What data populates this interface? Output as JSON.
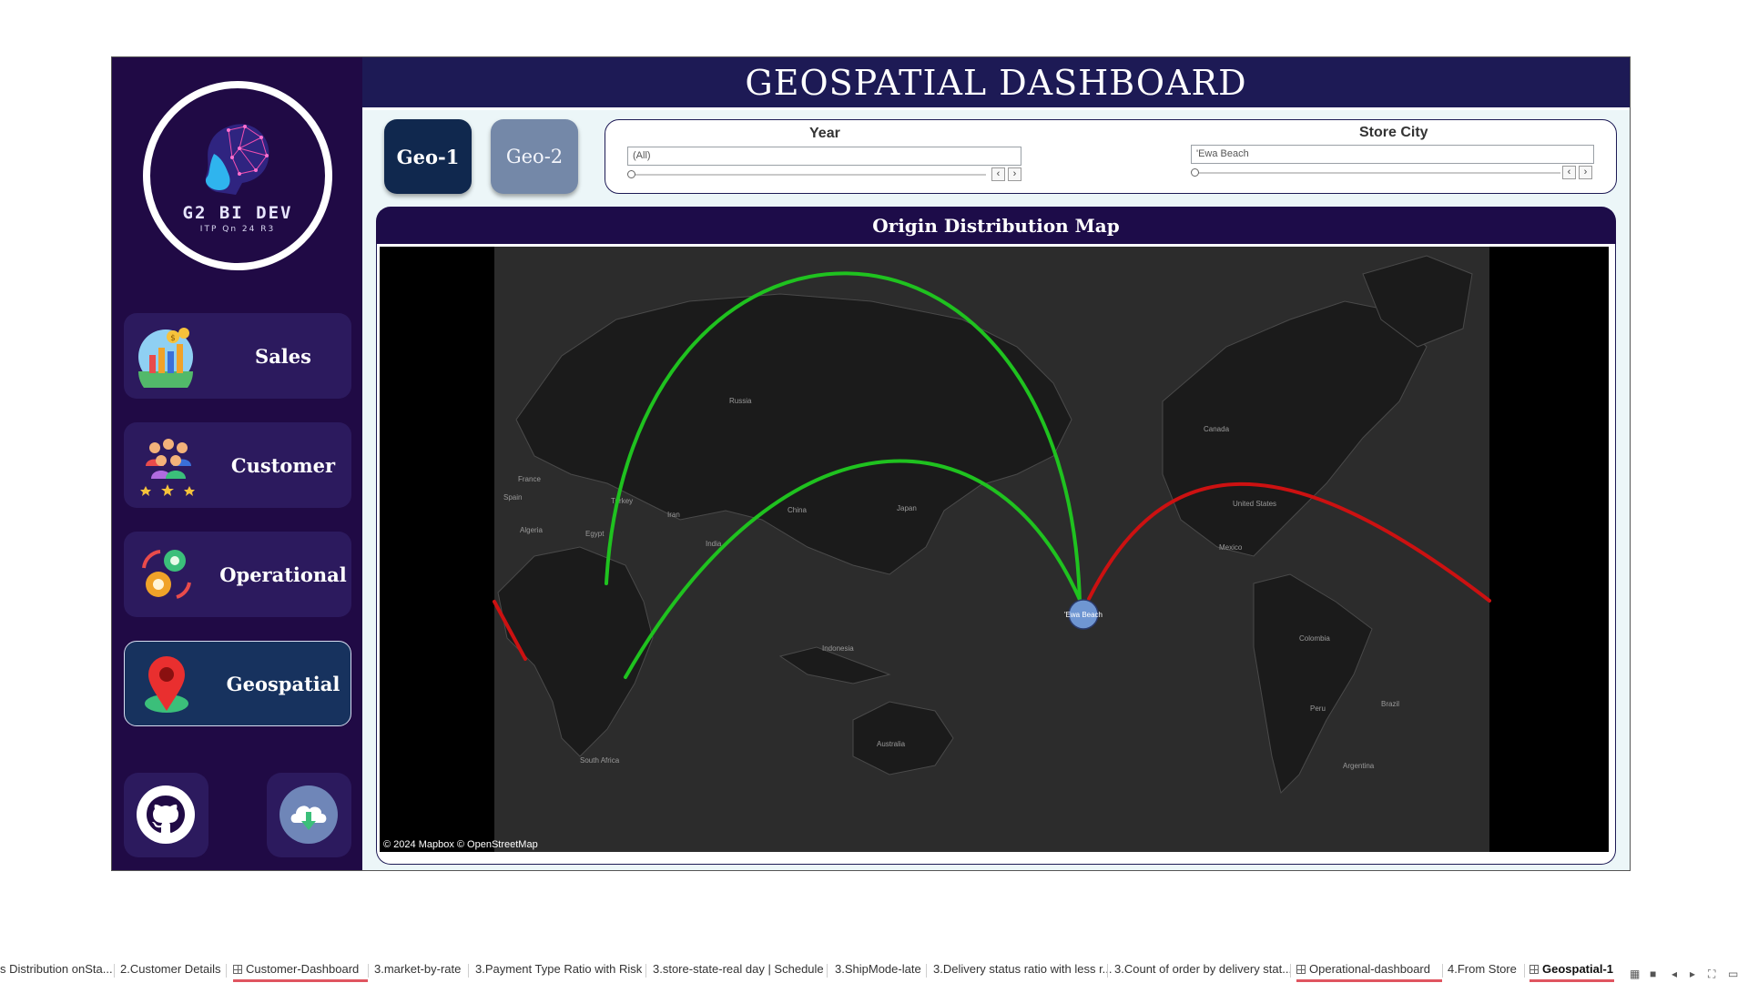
{
  "logo": {
    "brand": "G2 BI DEV",
    "subtitle": "ITP Qn 24 R3"
  },
  "nav": [
    {
      "label": "Sales",
      "icon": "sales-chart-icon"
    },
    {
      "label": "Customer",
      "icon": "customer-group-icon"
    },
    {
      "label": "Operational",
      "icon": "operational-gears-icon"
    },
    {
      "label": "Geospatial",
      "icon": "map-pin-icon",
      "active": true
    }
  ],
  "footer_icons": [
    "github-icon",
    "cloud-download-icon"
  ],
  "header": {
    "title": "GEOSPATIAL DASHBOARD"
  },
  "geo_buttons": {
    "geo1": "Geo-1",
    "geo2": "Geo-2"
  },
  "filters": {
    "year_label": "Year",
    "year_value": "(All)",
    "city_label": "Store City",
    "city_value": "'Ewa Beach"
  },
  "map": {
    "title": "Origin Distribution Map",
    "credit": "© 2024 Mapbox © OpenStreetMap",
    "place_labels": [
      "Russia",
      "Canada",
      "United States",
      "Mexico",
      "France",
      "Spain",
      "Algeria",
      "Egypt",
      "Turkey",
      "Iran",
      "India",
      "China",
      "Japan",
      "Indonesia",
      "Australia",
      "South Africa",
      "Colombia",
      "Peru",
      "Brazil",
      "Argentina"
    ],
    "marker_label": "'Ewa Beach",
    "arc_colors": {
      "inbound_green": "#1fc21f",
      "outbound_red": "#cc1111"
    }
  },
  "sheet_tabs": [
    {
      "label": "s Distribution onSta..."
    },
    {
      "label": "2.Customer Details"
    },
    {
      "label": "Customer-Dashboard",
      "dashboard": true
    },
    {
      "label": "3.market-by-rate"
    },
    {
      "label": "3.Payment Type Ratio with Risk"
    },
    {
      "label": "3.store-state-real day | Schedule"
    },
    {
      "label": "3.ShipMode-late"
    },
    {
      "label": "3.Delivery status ratio with less r..."
    },
    {
      "label": "3.Count of order by delivery stat..."
    },
    {
      "label": "Operational-dashboard",
      "dashboard": true
    },
    {
      "label": "4.From Store"
    },
    {
      "label": "Geospatial-1",
      "dashboard": true,
      "active": true
    }
  ],
  "colors": {
    "sidebar": "#200a45",
    "header": "#1d1a55",
    "accent_underline": "#e05560"
  }
}
